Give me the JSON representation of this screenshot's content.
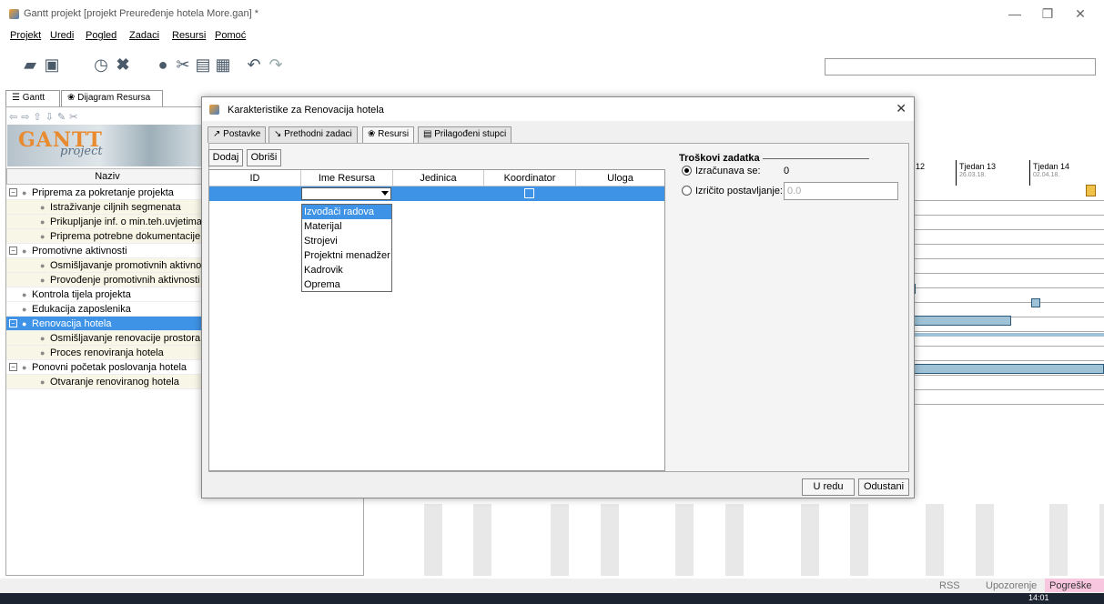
{
  "window": {
    "title": "Gantt projekt [projekt Preuređenje hotela More.gan] *",
    "controls": {
      "minimize": "—",
      "maximize": "❐",
      "close": "✕"
    }
  },
  "menu": [
    "Projekt",
    "Uredi",
    "Pogled",
    "Zadaci",
    "Resursi",
    "Pomoć"
  ],
  "main_tabs": [
    "Gantt",
    "Dijagram Resursa"
  ],
  "logo": {
    "word": "GANTT",
    "sub": "project"
  },
  "task_tree": {
    "header": "Naziv",
    "rows": [
      {
        "label": "Priprema za pokretanje projekta",
        "level": 0,
        "expander": "−"
      },
      {
        "label": "Istraživanje ciljnih segmenata",
        "level": 1
      },
      {
        "label": "Prikupljanje inf. o min.teh.uvjetima",
        "level": 1
      },
      {
        "label": "Priprema potrebne dokumentacije",
        "level": 1
      },
      {
        "label": "Promotivne aktivnosti",
        "level": 0,
        "expander": "−"
      },
      {
        "label": "Osmišljavanje promotivnih aktivnosti",
        "level": 1
      },
      {
        "label": "Provođenje promotivnih aktivnosti",
        "level": 1
      },
      {
        "label": "Kontrola tijela projekta",
        "level": 0
      },
      {
        "label": "Edukacija zaposlenika",
        "level": 0
      },
      {
        "label": "Renovacija hotela",
        "level": 0,
        "expander": "−",
        "selected": true
      },
      {
        "label": "Osmišljavanje renovacije prostora",
        "level": 1
      },
      {
        "label": "Proces renoviranja hotela",
        "level": 1
      },
      {
        "label": "Ponovni početak poslovanja hotela",
        "level": 0,
        "expander": "−"
      },
      {
        "label": "Otvaranje renoviranog hotela",
        "level": 1
      }
    ]
  },
  "chart_header": {
    "partial_week": "12",
    "weeks": [
      {
        "label": "Tjedan 13",
        "date": "26.03.18."
      },
      {
        "label": "Tjedan 14",
        "date": "02.04.18."
      }
    ]
  },
  "status": {
    "rss": "RSS",
    "warnings": "Upozorenje",
    "errors": "Pogreške",
    "time": "14:01"
  },
  "dialog": {
    "title": "Karakteristike za Renovacija hotela",
    "close": "✕",
    "tabs": [
      "Postavke",
      "Prethodni zadaci",
      "Resursi",
      "Prilagođeni stupci"
    ],
    "active_tab": "Resursi",
    "buttons": {
      "add": "Dodaj",
      "delete": "Obriši",
      "ok": "U redu",
      "cancel": "Odustani"
    },
    "table_headers": [
      "ID",
      "Ime Resursa",
      "Jedinica",
      "Koordinator",
      "Uloga"
    ],
    "dropdown_options": [
      "Izvođači radova",
      "Materijal",
      "Strojevi",
      "Projektni menadžer",
      "Kadrovik",
      "Oprema"
    ],
    "dropdown_highlighted": "Izvođači radova",
    "costs": {
      "legend": "Troškovi zadatka",
      "calculated_label": "Izračunava se:",
      "calculated_value": "0",
      "explicit_label": "Izričito postavljanje:",
      "explicit_value": "0.0",
      "selected": "calculated"
    }
  }
}
